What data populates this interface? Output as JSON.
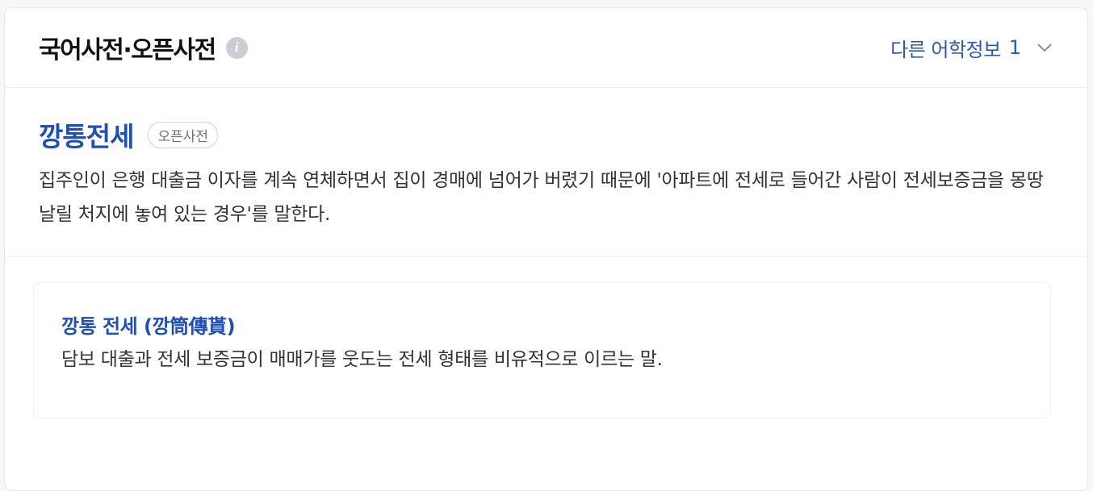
{
  "header": {
    "title": "국어사전·오픈사전",
    "info_icon": "i",
    "more_label": "다른 어학정보",
    "more_count": "1"
  },
  "entry": {
    "word": "깡통전세",
    "source_badge": "오픈사전",
    "definition": "집주인이 은행 대출금 이자를 계속 연체하면서 집이 경매에 넘어가 버렸기 때문에 '아파트에 전세로 들어간 사람이 전세보증금을 몽땅 날릴 처지에 놓여 있는 경우'를 말한다."
  },
  "related": {
    "word": "깡통 전세 (깡筒傳貰)",
    "definition": "담보 대출과 전세 보증금이 매매가를 웃도는 전세 형태를 비유적으로 이르는 말."
  },
  "colors": {
    "accent": "#1e4fb8",
    "link": "#2a5ab0"
  },
  "icons": [
    "info-icon",
    "chevron-down-icon"
  ]
}
